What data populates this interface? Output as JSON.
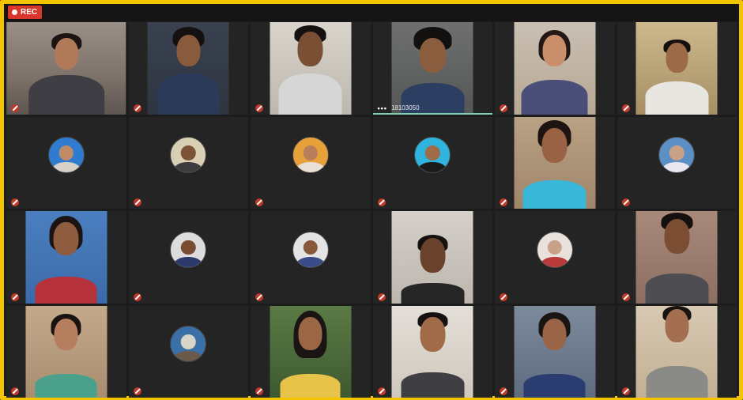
{
  "meeting": {
    "recording_label": "REC"
  },
  "participants": [
    {
      "name": "",
      "type": "video"
    },
    {
      "name": "",
      "type": "video"
    },
    {
      "name": "",
      "type": "video"
    },
    {
      "name": "18103050",
      "type": "video",
      "active": true
    },
    {
      "name": "",
      "type": "video"
    },
    {
      "name": "",
      "type": "video"
    },
    {
      "name": "",
      "type": "avatar"
    },
    {
      "name": "",
      "type": "avatar"
    },
    {
      "name": "",
      "type": "avatar"
    },
    {
      "name": "",
      "type": "avatar"
    },
    {
      "name": "",
      "type": "video"
    },
    {
      "name": "",
      "type": "avatar"
    },
    {
      "name": "",
      "type": "video"
    },
    {
      "name": "",
      "type": "avatar"
    },
    {
      "name": "",
      "type": "avatar"
    },
    {
      "name": "",
      "type": "video"
    },
    {
      "name": "",
      "type": "avatar"
    },
    {
      "name": "",
      "type": "video"
    },
    {
      "name": "",
      "type": "video"
    },
    {
      "name": "",
      "type": "avatar"
    },
    {
      "name": "",
      "type": "video"
    },
    {
      "name": "",
      "type": "video"
    },
    {
      "name": "",
      "type": "video"
    },
    {
      "name": "",
      "type": "video"
    }
  ]
}
